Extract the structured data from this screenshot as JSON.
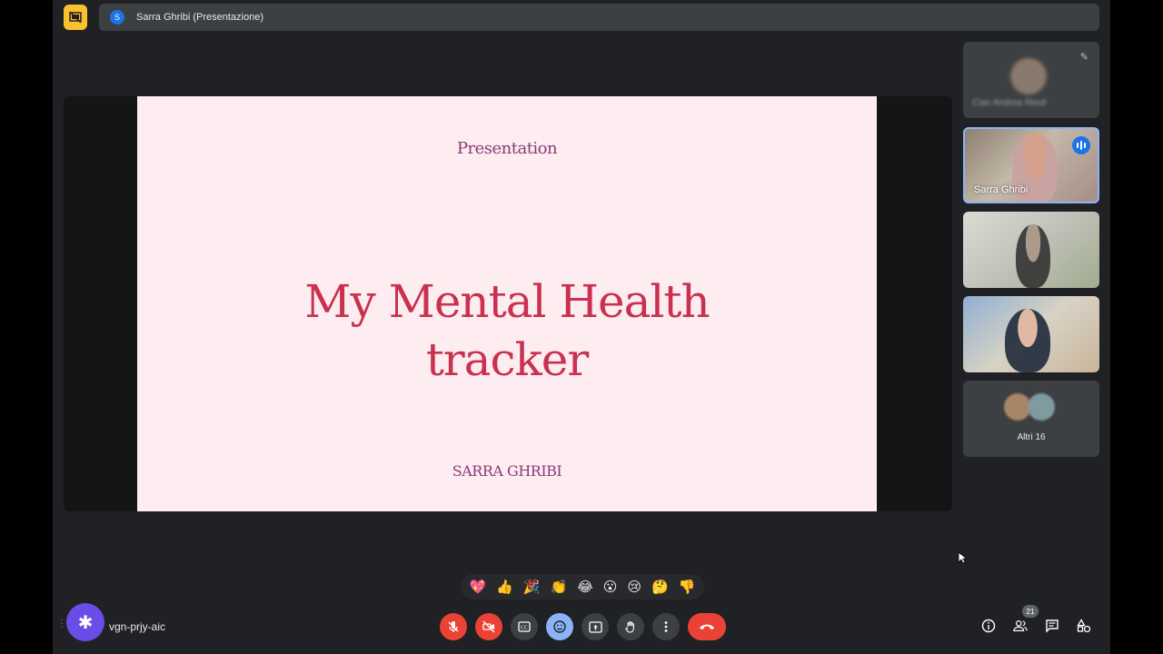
{
  "header": {
    "presenter_initial": "S",
    "presenter_label": "Sarra Ghribi (Presentazione)"
  },
  "slide": {
    "kicker": "Presentation",
    "title_line1": "My Mental Health",
    "title_line2": "tracker",
    "author": "SARRA GHRIBI"
  },
  "participants": [
    {
      "name": "Cian Andrea Rieof",
      "blurred": true
    },
    {
      "name": "Sarra Ghribi",
      "speaking": true
    },
    {
      "name": ""
    },
    {
      "name": ""
    }
  ],
  "others": {
    "label": "Altri 16"
  },
  "reactions": [
    "💖",
    "👍",
    "🎉",
    "👏",
    "😂",
    "😮",
    "😢",
    "🤔",
    "👎"
  ],
  "bottom": {
    "meeting_code": "vgn-prjy-aic",
    "people_count": "21"
  },
  "colors": {
    "background": "#202124",
    "slide_bg": "#fdedf0",
    "slide_title": "#c9314f",
    "slide_accent": "#8b3a7a",
    "danger": "#ea4335",
    "active": "#8ab4f8",
    "app_accent": "#6a4ce6"
  }
}
